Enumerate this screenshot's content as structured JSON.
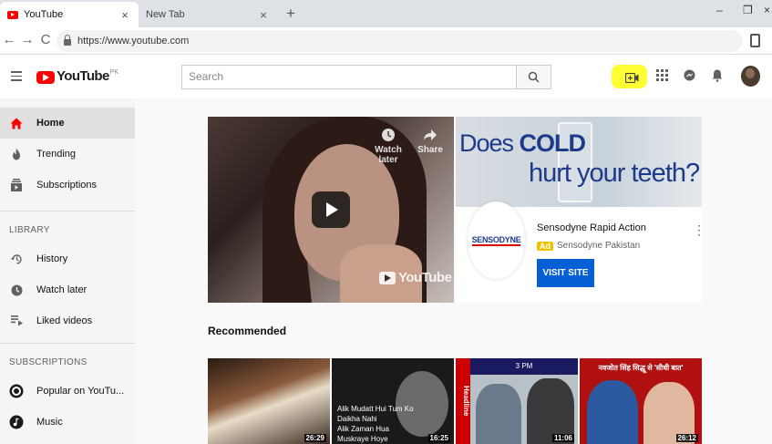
{
  "browser": {
    "tabs": [
      {
        "title": "YouTube",
        "close": "×"
      },
      {
        "title": "New Tab",
        "close": "×"
      }
    ],
    "new_tab": "+",
    "window": {
      "minimize": "–",
      "restore": "❐",
      "close": "×"
    },
    "nav": {
      "back": "←",
      "forward": "→",
      "reload": "C"
    },
    "url": "https://www.youtube.com"
  },
  "masthead": {
    "logo_text": "YouTube",
    "country_code": "PK",
    "search_placeholder": "Search",
    "icons": [
      "menu-icon",
      "search-icon",
      "create-video-icon",
      "apps-icon",
      "messages-icon",
      "notifications-icon"
    ],
    "highlight_color": "#ffff33"
  },
  "sidebar": {
    "main": [
      {
        "label": "Home",
        "icon": "home-icon"
      },
      {
        "label": "Trending",
        "icon": "flame-icon"
      },
      {
        "label": "Subscriptions",
        "icon": "subscriptions-icon"
      }
    ],
    "library_heading": "LIBRARY",
    "library": [
      {
        "label": "History",
        "icon": "history-icon"
      },
      {
        "label": "Watch later",
        "icon": "clock-icon"
      },
      {
        "label": "Liked videos",
        "icon": "liked-videos-icon"
      }
    ],
    "subscriptions_heading": "SUBSCRIPTIONS",
    "subscriptions": [
      {
        "label": "Popular on YouTu...",
        "icon": "popular-channel-icon"
      },
      {
        "label": "Music",
        "icon": "music-channel-icon"
      }
    ]
  },
  "hero": {
    "watch_later": "Watch later",
    "share": "Share",
    "watermark": "YouTube"
  },
  "ad": {
    "banner_line1_a": "Does ",
    "banner_line1_b": "COLD",
    "banner_line2": "hurt your teeth?",
    "logo_text": "SENSODYNE",
    "title": "Sensodyne Rapid Action",
    "badge": "Ad",
    "advertiser": "Sensodyne Pakistan",
    "cta": "VISIT SITE",
    "brand_color": "#065fd4",
    "badge_color": "#f2c200"
  },
  "recommended": {
    "heading": "Recommended",
    "videos": [
      {
        "duration": "26:29"
      },
      {
        "duration": "16:25",
        "caption_line1": "Alik Mudatt Hui Tum Ko Daikha Nahi",
        "caption_line2": "Alik Zaman Hua Muskraye Hoye"
      },
      {
        "duration": "11:06",
        "banner": "Headline",
        "top": "3 PM"
      },
      {
        "duration": "26:12",
        "caption": "नवजोत सिंह सिद्धू से 'सीधी बात'"
      }
    ]
  }
}
